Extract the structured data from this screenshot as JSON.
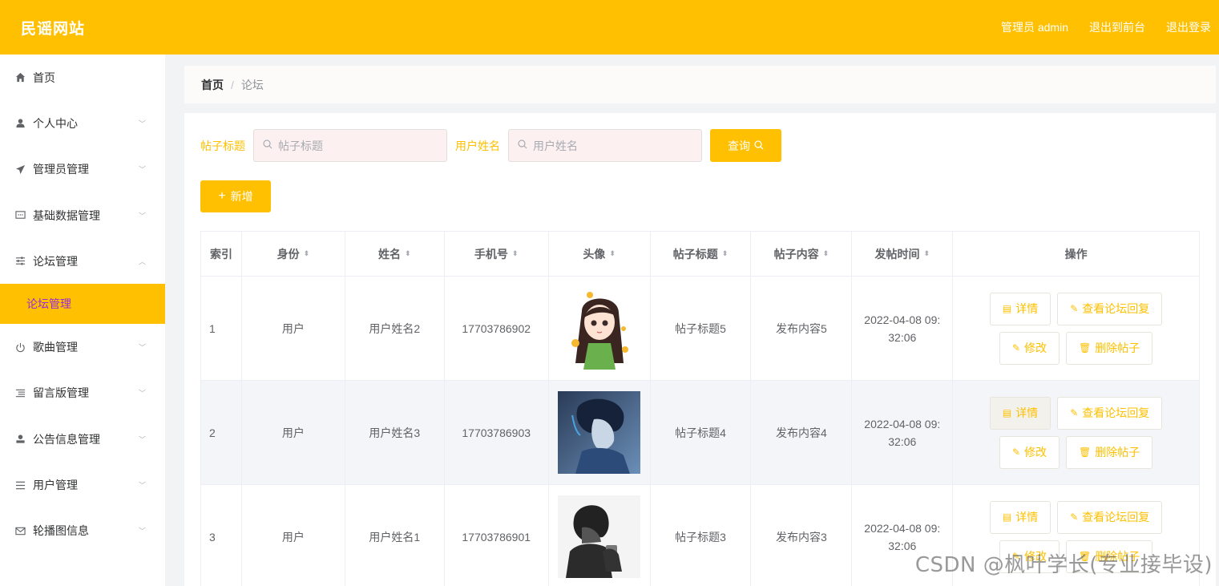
{
  "header": {
    "brand": "民谣网站",
    "user": "管理员 admin",
    "to_front": "退出到前台",
    "logout": "退出登录"
  },
  "sidebar": {
    "items": [
      {
        "label": "首页",
        "icon": "home-icon"
      },
      {
        "label": "个人中心",
        "icon": "user-icon"
      },
      {
        "label": "管理员管理",
        "icon": "send-icon"
      },
      {
        "label": "基础数据管理",
        "icon": "message-icon"
      },
      {
        "label": "论坛管理",
        "icon": "sliders-icon"
      },
      {
        "label": "论坛管理",
        "icon": ""
      },
      {
        "label": "歌曲管理",
        "icon": "power-icon"
      },
      {
        "label": "留言版管理",
        "icon": "list-icon"
      },
      {
        "label": "公告信息管理",
        "icon": "user-solid-icon"
      },
      {
        "label": "用户管理",
        "icon": "menu-icon"
      },
      {
        "label": "轮播图信息",
        "icon": "mail-icon"
      }
    ]
  },
  "breadcrumb": {
    "home": "首页",
    "sep": "/",
    "current": "论坛"
  },
  "search": {
    "title_label": "帖子标题",
    "title_placeholder": "帖子标题",
    "name_label": "用户姓名",
    "name_placeholder": "用户姓名",
    "query_button": "查询"
  },
  "add_button": "新增",
  "table": {
    "headers": [
      "索引",
      "身份",
      "姓名",
      "手机号",
      "头像",
      "帖子标题",
      "帖子内容",
      "发帖时间",
      "操作"
    ],
    "rows": [
      {
        "index": "1",
        "role": "用户",
        "name": "用户姓名2",
        "phone": "17703786902",
        "title": "帖子标题5",
        "content": "发布内容5",
        "time_line1": "2022-04-08 09:",
        "time_line2": "32:06"
      },
      {
        "index": "2",
        "role": "用户",
        "name": "用户姓名3",
        "phone": "17703786903",
        "title": "帖子标题4",
        "content": "发布内容4",
        "time_line1": "2022-04-08 09:",
        "time_line2": "32:06"
      },
      {
        "index": "3",
        "role": "用户",
        "name": "用户姓名1",
        "phone": "17703786901",
        "title": "帖子标题3",
        "content": "发布内容3",
        "time_line1": "2022-04-08 09:",
        "time_line2": "32:06"
      }
    ],
    "ops": {
      "detail": "详情",
      "view_reply": "查看论坛回复",
      "edit": "修改",
      "delete": "删除帖子"
    }
  },
  "watermark": "CSDN @枫叶学长(专业接毕设)",
  "colors": {
    "accent": "#fec000",
    "submenu_text": "#9b2cd6"
  }
}
